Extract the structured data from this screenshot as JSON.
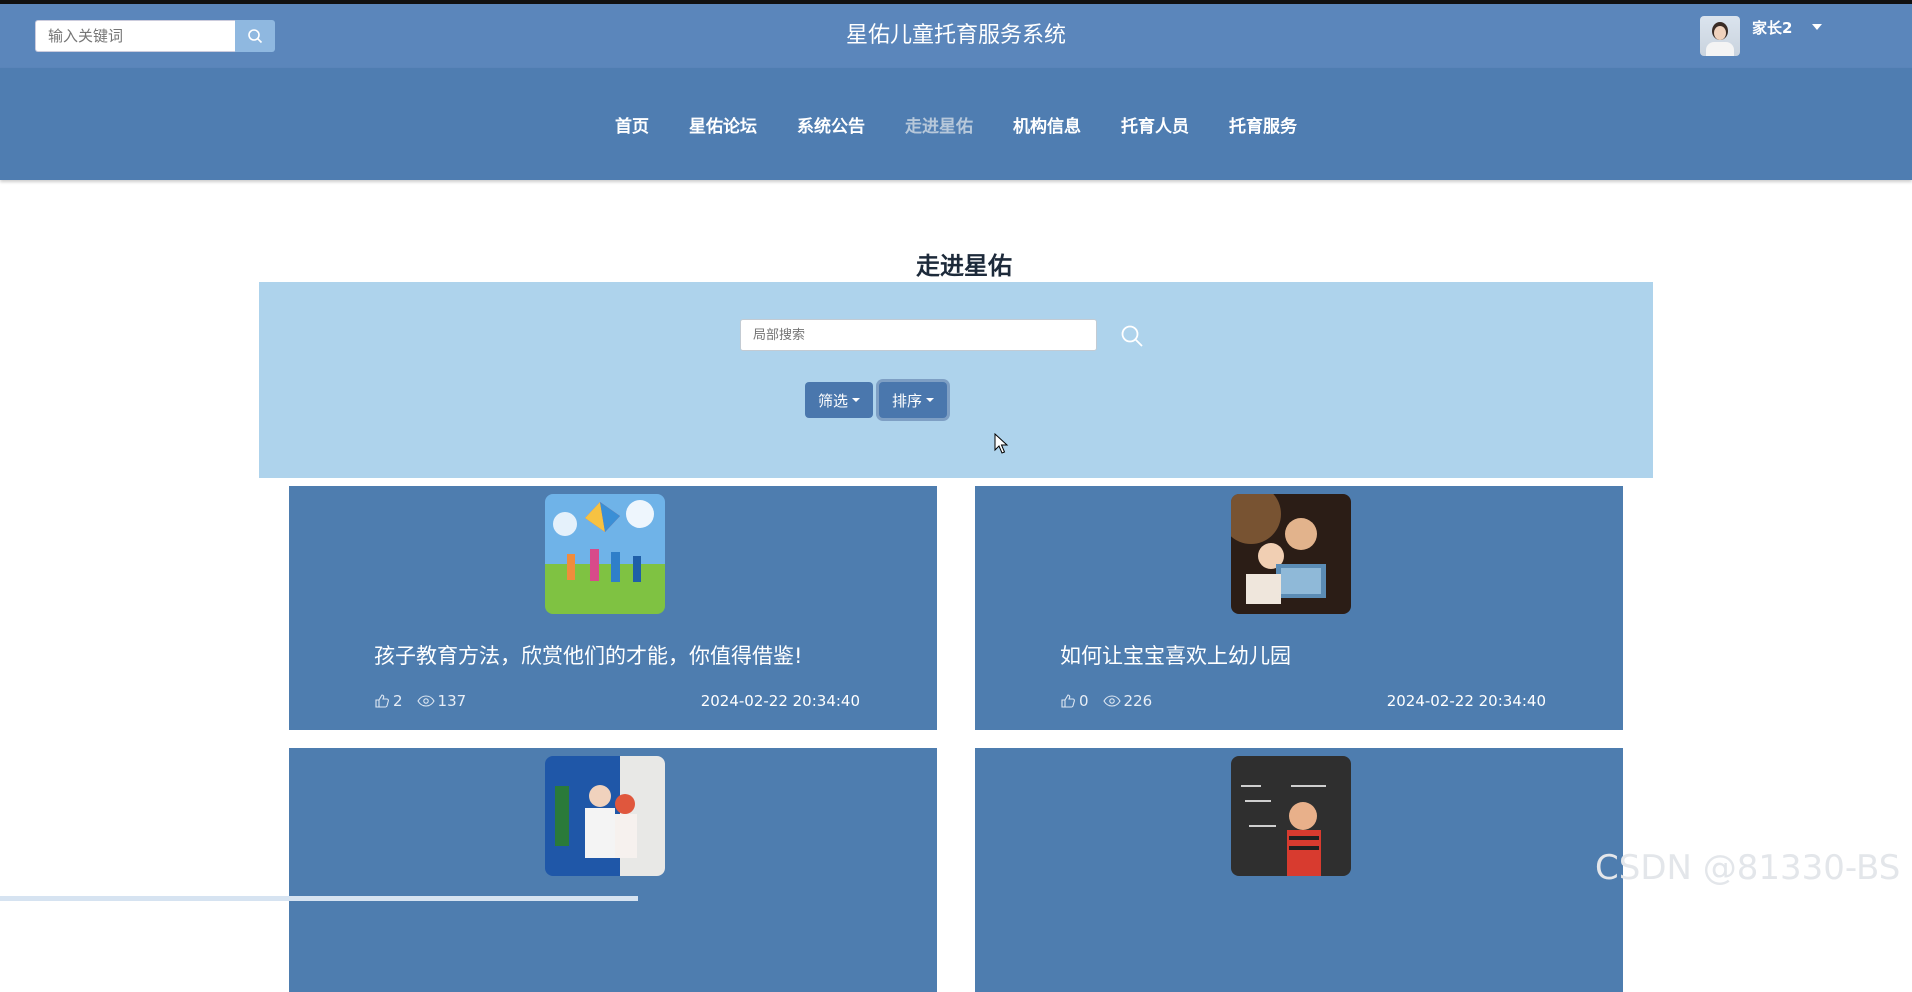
{
  "header": {
    "search_placeholder": "输入关键词",
    "site_title": "星佑儿童托育服务系统",
    "user_name": "家长2"
  },
  "nav": {
    "items": [
      {
        "label": "首页",
        "active": false
      },
      {
        "label": "星佑论坛",
        "active": false
      },
      {
        "label": "系统公告",
        "active": false
      },
      {
        "label": "走进星佑",
        "active": true
      },
      {
        "label": "机构信息",
        "active": false
      },
      {
        "label": "托育人员",
        "active": false
      },
      {
        "label": "托育服务",
        "active": false
      }
    ]
  },
  "main": {
    "title": "走进星佑",
    "local_search_placeholder": "局部搜索",
    "filter_label": "筛选",
    "sort_label": "排序"
  },
  "articles": [
    {
      "title": "孩子教育方法，欣赏他们的才能，你值得借鉴!",
      "likes": "2",
      "views": "137",
      "date": "2024-02-22 20:34:40"
    },
    {
      "title": "如何让宝宝喜欢上幼儿园",
      "likes": "0",
      "views": "226",
      "date": "2024-02-22 20:34:40"
    },
    {
      "title": "",
      "likes": "",
      "views": "",
      "date": ""
    },
    {
      "title": "",
      "likes": "",
      "views": "",
      "date": ""
    }
  ],
  "watermark": "CSDN @81330-BS",
  "colors": {
    "header": "#5b86bb",
    "nav": "#4f7db1",
    "panel": "#aed3ec",
    "card": "#4e7daf"
  }
}
